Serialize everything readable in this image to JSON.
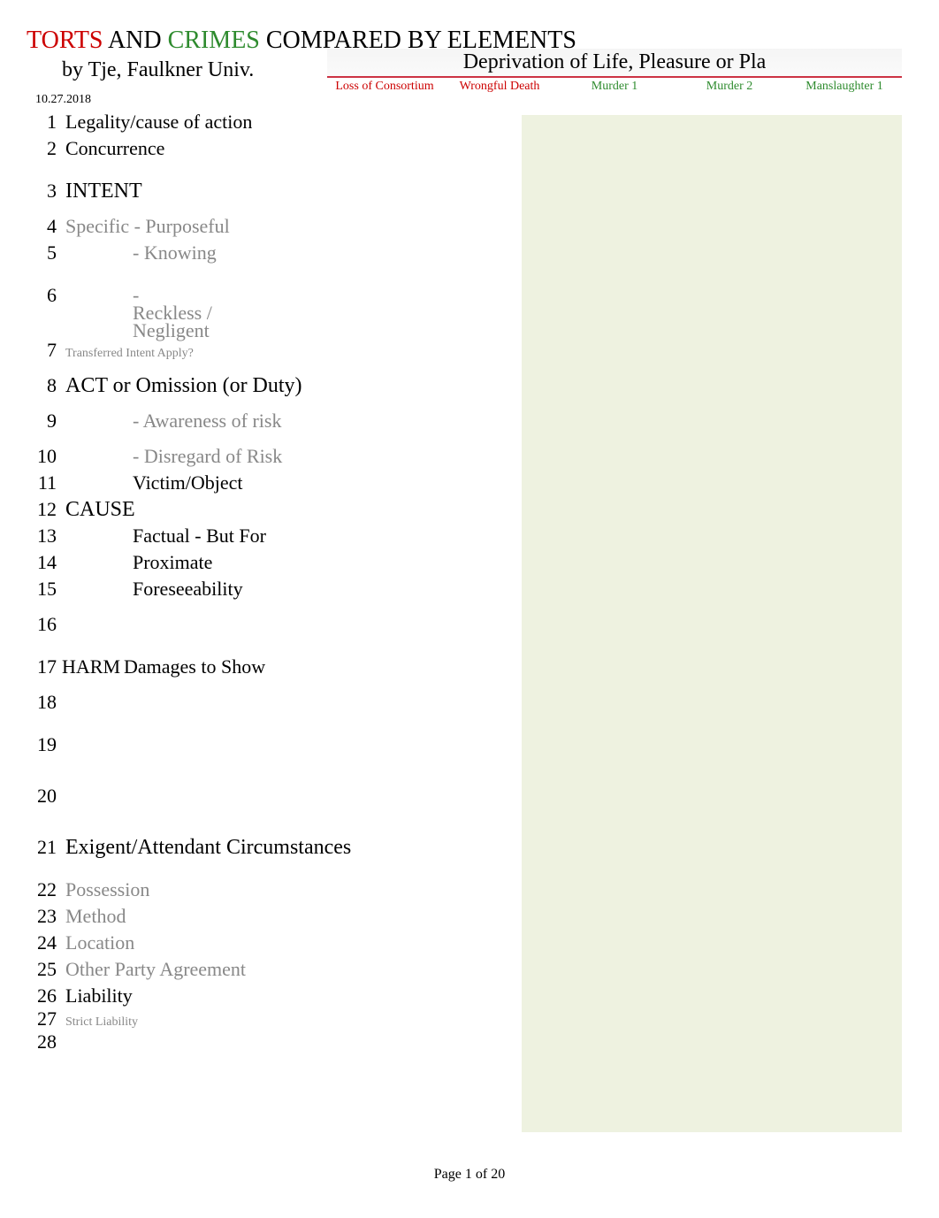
{
  "title": {
    "torts": "TORTS",
    "and": "  AND  ",
    "crimes": "CRIMES",
    "rest": "  COMPARED BY ELEMENTS"
  },
  "byline": "by Tje, Faulkner Univ.",
  "date": "10.27.2018",
  "category_title": "Deprivation of Life, Pleasure or Pla",
  "columns": [
    {
      "label": "Loss of Consortium",
      "cls": "col-red"
    },
    {
      "label": "Wrongful Death",
      "cls": "col-red"
    },
    {
      "label": "Murder 1",
      "cls": "col-green"
    },
    {
      "label": "Murder 2",
      "cls": "col-green"
    },
    {
      "label": "Manslaughter 1",
      "cls": "col-green"
    }
  ],
  "rows": [
    {
      "n": "1",
      "text": "Legality/cause of action",
      "cls": "cell",
      "rh": "r-h"
    },
    {
      "n": "2",
      "text": "Concurrence",
      "cls": "cell",
      "rh": "r-h3"
    },
    {
      "n": "3",
      "text": "INTENT",
      "cls": "cell section-head",
      "rh": "r-h2"
    },
    {
      "n": "4",
      "text": "Specific - Purposeful",
      "cls": "cell cell-gray",
      "rh": "r-h"
    },
    {
      "n": "5",
      "text": "- Knowing",
      "cls": "cell cell-gray indent1",
      "rh": "r-h3"
    },
    {
      "n": "6",
      "text": "- Reckless / Negligent",
      "cls": "cell cell-gray indent1",
      "rh": "r-h",
      "overlap": true
    },
    {
      "n": "7",
      "text": "Transferred Intent Apply?",
      "cls": "cell cell-small",
      "rh": "r-h2"
    },
    {
      "n": "8",
      "text": "ACT or Omission (or Duty)",
      "cls": "cell section-head",
      "rh": "r-h2"
    },
    {
      "n": "9",
      "text": "- Awareness of risk",
      "cls": "cell cell-gray indent1",
      "rh": "r-h2"
    },
    {
      "n": "10",
      "text": "- Disregard of Risk",
      "cls": "cell cell-gray indent1",
      "rh": "r-h"
    },
    {
      "n": "11",
      "text": "Victim/Object",
      "cls": "cell indent2",
      "rh": "r-h"
    },
    {
      "n": "12",
      "text": "CAUSE",
      "cls": "cell section-head",
      "rh": "r-h"
    },
    {
      "n": "13",
      "text": "Factual - But For",
      "cls": "cell indent2",
      "rh": "r-h"
    },
    {
      "n": "14",
      "text": "Proximate",
      "cls": "cell indent2",
      "rh": "r-h"
    },
    {
      "n": "15",
      "text": "Foreseeability",
      "cls": "cell indent2",
      "rh": "r-h2"
    },
    {
      "n": "16",
      "text": "",
      "cls": "cell",
      "rh": "r-h3"
    },
    {
      "n": "17",
      "text": "HARM",
      "text2": "Damages to Show",
      "cls": "cell",
      "rh": "r-h2",
      "harm": true
    },
    {
      "n": "18",
      "text": "",
      "cls": "cell",
      "rh": "r-h3"
    },
    {
      "n": "19",
      "text": "",
      "cls": "cell",
      "rh": "r-h4"
    },
    {
      "n": "20",
      "text": "",
      "cls": "cell",
      "rh": "r-h4"
    },
    {
      "n": "21",
      "text": "Exigent/Attendant Circumstances",
      "cls": "cell section-head",
      "rh": "r-h3"
    },
    {
      "n": "22",
      "text": "Possession",
      "cls": "cell cell-gray",
      "rh": "r-h"
    },
    {
      "n": "23",
      "text": "Method",
      "cls": "cell cell-gray",
      "rh": "r-h"
    },
    {
      "n": "24",
      "text": "Location",
      "cls": "cell cell-gray",
      "rh": "r-h"
    },
    {
      "n": "25",
      "text": "Other Party Agreement",
      "cls": "cell cell-gray",
      "rh": "r-h"
    },
    {
      "n": "26",
      "text": "Liability",
      "cls": "cell",
      "rh": "r-small"
    },
    {
      "n": "27",
      "text": "Strict Liability",
      "cls": "cell cell-small",
      "rh": "r-small"
    },
    {
      "n": "28",
      "text": "",
      "cls": "cell",
      "rh": "r-h"
    }
  ],
  "footer": "Page 1 of 20"
}
